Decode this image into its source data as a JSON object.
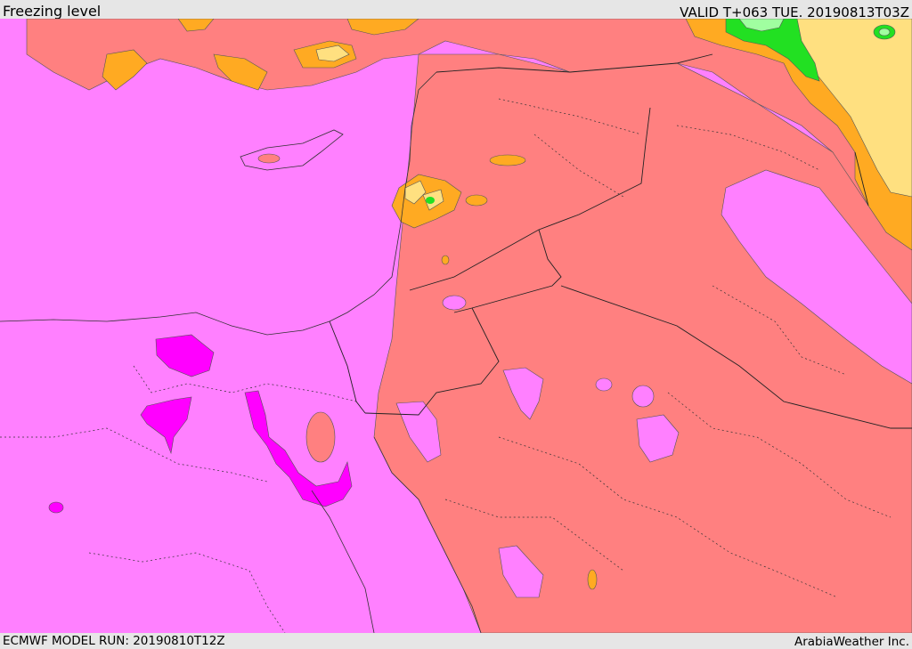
{
  "header": {
    "title": "Freezing level",
    "valid_time": "VALID T+063 TUE. 20190813T03Z"
  },
  "footer": {
    "model_run": "ECMWF MODEL RUN: 20190810T12Z",
    "credit": "ArabiaWeather Inc."
  },
  "colors": {
    "magenta_light": "#ff80ff",
    "magenta_dark": "#ff00ff",
    "salmon": "#ff8080",
    "orange": "#ffaa22",
    "yellow": "#ffe080",
    "green": "#22e022",
    "light_green": "#a0ffa0"
  }
}
